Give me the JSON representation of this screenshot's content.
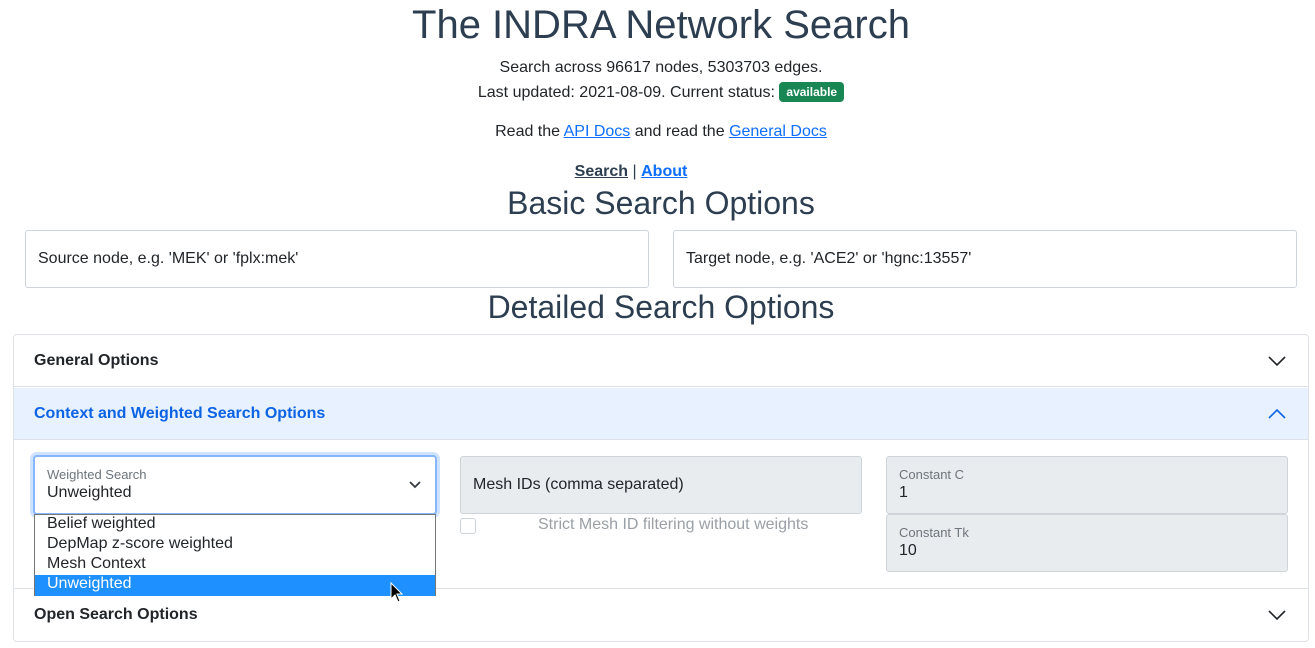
{
  "header": {
    "title": "The INDRA Network Search",
    "stats": "Search across 96617 nodes, 5303703 edges.",
    "updated_prefix": "Last updated: 2021-08-09. Current status:",
    "status_badge": "available",
    "docs_prefix": "Read the",
    "api_docs_label": "API Docs",
    "docs_middle": "and read the",
    "general_docs_label": "General Docs"
  },
  "nav": {
    "search_label": "Search",
    "separator": "|",
    "about_label": "About"
  },
  "basic": {
    "heading": "Basic Search Options",
    "source_placeholder": "Source node, e.g. 'MEK' or 'fplx:mek'",
    "target_placeholder": "Target node, e.g. 'ACE2' or 'hgnc:13557'"
  },
  "detailed": {
    "heading": "Detailed Search Options",
    "general_options_label": "General Options",
    "context_options_label": "Context and Weighted Search Options",
    "open_options_label": "Open Search Options"
  },
  "context": {
    "weighted_search_label": "Weighted Search",
    "weighted_search_value": "Unweighted",
    "weighted_options": [
      "Belief weighted",
      "DepMap z-score weighted",
      "Mesh Context",
      "Unweighted"
    ],
    "mesh_ids_placeholder": "Mesh IDs (comma separated)",
    "strict_mesh_label": "Strict Mesh ID filtering without weights",
    "constant_c_label": "Constant C",
    "constant_c_value": "1",
    "constant_tk_label": "Constant Tk",
    "constant_tk_value": "10"
  },
  "colors": {
    "heading": "#2c3e50",
    "link": "#0d6efd",
    "badge": "#198754",
    "accordion_open_bg": "#e7f1ff",
    "accordion_open_text": "#0c63e4",
    "option_selected": "#1e90ff"
  },
  "icons": [
    "chevron-down-icon",
    "chevron-up-icon",
    "select-caret-icon",
    "mouse-cursor-icon"
  ]
}
